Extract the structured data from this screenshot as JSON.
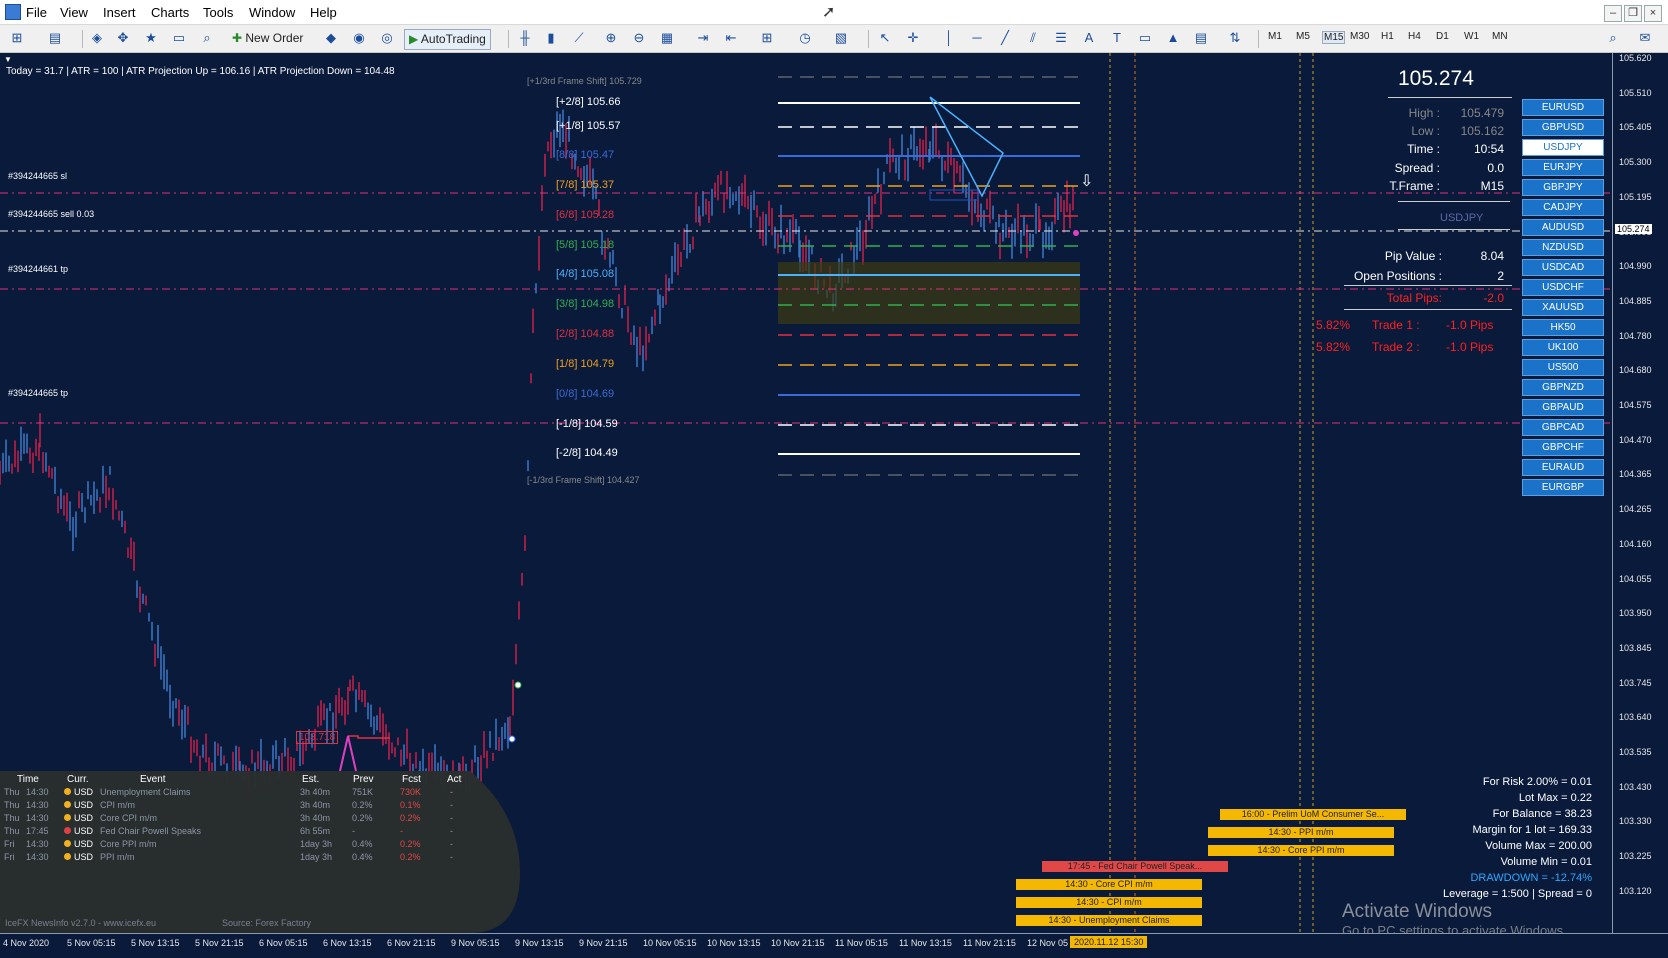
{
  "menu": [
    "File",
    "View",
    "Insert",
    "Charts",
    "Tools",
    "Window",
    "Help"
  ],
  "window_controls": [
    "–",
    "❐",
    "×"
  ],
  "toolbar": {
    "new_order": "New Order",
    "autotrading": "AutoTrading",
    "timeframes": [
      "M1",
      "M5",
      "M15",
      "M30",
      "H1",
      "H4",
      "D1",
      "W1",
      "MN"
    ]
  },
  "info_line": "Today = 31.7   |   ATR = 100   |   ATR Projection Up = 106.16   |   ATR Projection Down = 104.48",
  "murrey": {
    "frame_shift_up": "[+1/3rd Frame Shift]  105.729",
    "frame_shift_down": "[-1/3rd Frame Shift]  104.427",
    "levels": [
      {
        "label": "[+2/8]  105.66",
        "color": "#ffffff"
      },
      {
        "label": "[+1/8]  105.57",
        "color": "#ffffff"
      },
      {
        "label": "[8/8]  105.47",
        "color": "#3a6bd6"
      },
      {
        "label": "[7/8]  105.37",
        "color": "#f0a020"
      },
      {
        "label": "[6/8]  105.28",
        "color": "#e03040"
      },
      {
        "label": "[5/8]  105.18",
        "color": "#30b050"
      },
      {
        "label": "[4/8]  105.08",
        "color": "#4ab0ff"
      },
      {
        "label": "[3/8]  104.98",
        "color": "#30b050"
      },
      {
        "label": "[2/8]  104.88",
        "color": "#e03040"
      },
      {
        "label": "[1/8]  104.79",
        "color": "#f0a020"
      },
      {
        "label": "[0/8]  104.69",
        "color": "#3a6bd6"
      },
      {
        "label": "[-1/8]  104.59",
        "color": "#ffffff"
      },
      {
        "label": "[-2/8]  104.49",
        "color": "#ffffff"
      }
    ]
  },
  "order_lines": [
    {
      "label": "#394244665 sl"
    },
    {
      "label": "#394244665 sell 0.03"
    },
    {
      "label": "#394244661 tp"
    },
    {
      "label": "#394244665 tp"
    }
  ],
  "price_marker": "103.718",
  "price_labels": {
    "current": "105.274",
    "small_current": "105.274"
  },
  "price_axis": [
    "105.620",
    "105.510",
    "105.405",
    "105.300",
    "105.195",
    "105.095",
    "104.990",
    "104.885",
    "104.780",
    "104.680",
    "104.575",
    "104.470",
    "104.365",
    "104.265",
    "104.160",
    "104.055",
    "103.950",
    "103.845",
    "103.745",
    "103.640",
    "103.535",
    "103.430",
    "103.330",
    "103.225",
    "103.120"
  ],
  "time_axis": [
    "4 Nov 2020",
    "5 Nov 05:15",
    "5 Nov 13:15",
    "5 Nov 21:15",
    "6 Nov 05:15",
    "6 Nov 13:15",
    "6 Nov 21:15",
    "9 Nov 05:15",
    "9 Nov 13:15",
    "9 Nov 21:15",
    "10 Nov 05:15",
    "10 Nov 13:15",
    "10 Nov 21:15",
    "11 Nov 05:15",
    "11 Nov 13:15",
    "11 Nov 21:15",
    "12 Nov 05"
  ],
  "time_cursor": "2020.11.12 15:30",
  "panel": {
    "price": "105.274",
    "high_label": "High :",
    "high": "105.479",
    "low_label": "Low :",
    "low": "105.162",
    "time_label": "Time :",
    "time": "10:54",
    "spread_label": "Spread :",
    "spread": "0.0",
    "tframe_label": "T.Frame :",
    "tframe": "M15",
    "symbol": "USDJPY",
    "pip_label": "Pip Value :",
    "pip": "8.04",
    "openpos_label": "Open Positions :",
    "openpos": "2",
    "totalpips_label": "Total Pips:",
    "totalpips": "-2.0",
    "trades": [
      {
        "pct": "5.82%",
        "label": "Trade 1 :",
        "pips": "-1.0 Pips"
      },
      {
        "pct": "5.82%",
        "label": "Trade 2 :",
        "pips": "-1.0 Pips"
      }
    ]
  },
  "symbols": [
    "EURUSD",
    "GBPUSD",
    "USDJPY",
    "EURJPY",
    "GBPJPY",
    "CADJPY",
    "AUDUSD",
    "NZDUSD",
    "USDCAD",
    "USDCHF",
    "XAUUSD",
    "HK50",
    "UK100",
    "US500",
    "GBPNZD",
    "GBPAUD",
    "GBPCAD",
    "GBPCHF",
    "EURAUD",
    "EURGBP"
  ],
  "active_symbol": "USDJPY",
  "news": {
    "headers": [
      "Time",
      "Curr.",
      "Event",
      "Est.",
      "Prev",
      "Fcst",
      "Act"
    ],
    "rows": [
      {
        "day": "Thu",
        "time": "14:30",
        "dot": "#f0b020",
        "curr": "USD",
        "event": "Unemployment Claims",
        "est": "3h 40m",
        "prev": "751K",
        "fcst": "730K",
        "act": "-"
      },
      {
        "day": "Thu",
        "time": "14:30",
        "dot": "#f0b020",
        "curr": "USD",
        "event": "CPI m/m",
        "est": "3h 40m",
        "prev": "0.2%",
        "fcst": "0.1%",
        "act": "-"
      },
      {
        "day": "Thu",
        "time": "14:30",
        "dot": "#f0b020",
        "curr": "USD",
        "event": "Core CPI m/m",
        "est": "3h 40m",
        "prev": "0.2%",
        "fcst": "0.2%",
        "act": "-"
      },
      {
        "day": "Thu",
        "time": "17:45",
        "dot": "#e04040",
        "curr": "USD",
        "event": "Fed Chair Powell Speaks",
        "est": "6h 55m",
        "prev": "-",
        "fcst": "-",
        "act": "-"
      },
      {
        "day": "Fri",
        "time": "14:30",
        "dot": "#f0b020",
        "curr": "USD",
        "event": "Core PPI m/m",
        "est": "1day 3h",
        "prev": "0.4%",
        "fcst": "0.2%",
        "act": "-"
      },
      {
        "day": "Fri",
        "time": "14:30",
        "dot": "#f0b020",
        "curr": "USD",
        "event": "PPI m/m",
        "est": "1day 3h",
        "prev": "0.4%",
        "fcst": "0.2%",
        "act": "-"
      }
    ],
    "footer_left": "IceFX NewsInfo v2.7.0  -  www.icefx.eu",
    "footer_right": "Source: Forex Factory"
  },
  "event_bars": [
    {
      "text": "16:00 - Prelim UoM Consumer Se...",
      "color": "#f5b800"
    },
    {
      "text": "14:30 - PPI m/m",
      "color": "#f5b800"
    },
    {
      "text": "14:30 - Core PPI m/m",
      "color": "#f5b800"
    },
    {
      "text": "17:45 - Fed Chair Powell Speak...",
      "color": "#e04848"
    },
    {
      "text": "14:30 - Core CPI m/m",
      "color": "#f5b800"
    },
    {
      "text": "14:30 - CPI m/m",
      "color": "#f5b800"
    },
    {
      "text": "14:30 - Unemployment Claims",
      "color": "#f5b800"
    }
  ],
  "risk": [
    {
      "text": "For Risk 2.00% = 0.01",
      "color": "#ffffff"
    },
    {
      "text": "Lot Max = 0.22",
      "color": "#ffffff"
    },
    {
      "text": "For Balance = 38.23",
      "color": "#ffffff"
    },
    {
      "text": "Margin for 1 lot = 169.33",
      "color": "#ffffff"
    },
    {
      "text": "Volume Max = 200.00",
      "color": "#ffffff"
    },
    {
      "text": "Volume Min = 0.01",
      "color": "#ffffff"
    },
    {
      "text": "DRAWDOWN = -12.74%",
      "color": "#2ea8ff"
    },
    {
      "text": "Leverage = 1:500 | Spread = 0",
      "color": "#ffffff"
    }
  ],
  "watermark": {
    "title": "Activate Windows",
    "sub": "Go to PC settings to activate Windows."
  }
}
